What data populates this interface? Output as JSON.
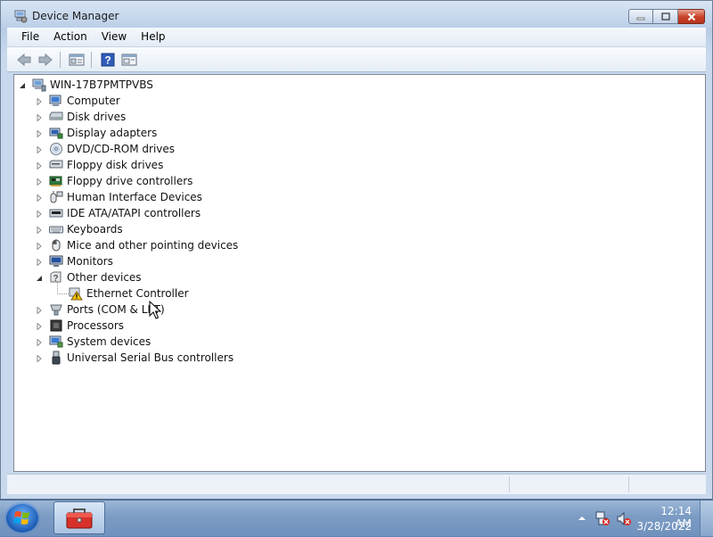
{
  "window": {
    "title": "Device Manager"
  },
  "menu": [
    "File",
    "Action",
    "View",
    "Help"
  ],
  "toolbar": {
    "buttons": [
      "back-icon",
      "forward-icon",
      "properties-icon",
      "help-icon",
      "details-icon"
    ]
  },
  "tree": {
    "root": {
      "label": "WIN-17B7PMTPVBS",
      "expanded": true,
      "icon": "computer-network-icon"
    },
    "categories": [
      {
        "label": "Computer",
        "icon": "computer-icon",
        "expanded": false
      },
      {
        "label": "Disk drives",
        "icon": "disk-drive-icon",
        "expanded": false
      },
      {
        "label": "Display adapters",
        "icon": "display-adapter-icon",
        "expanded": false
      },
      {
        "label": "DVD/CD-ROM drives",
        "icon": "dvd-drive-icon",
        "expanded": false
      },
      {
        "label": "Floppy disk drives",
        "icon": "floppy-disk-icon",
        "expanded": false
      },
      {
        "label": "Floppy drive controllers",
        "icon": "floppy-controller-icon",
        "expanded": false
      },
      {
        "label": "Human Interface Devices",
        "icon": "hid-icon",
        "expanded": false
      },
      {
        "label": "IDE ATA/ATAPI controllers",
        "icon": "ide-controller-icon",
        "expanded": false
      },
      {
        "label": "Keyboards",
        "icon": "keyboard-icon",
        "expanded": false
      },
      {
        "label": "Mice and other pointing devices",
        "icon": "mouse-icon",
        "expanded": false
      },
      {
        "label": "Monitors",
        "icon": "monitor-icon",
        "expanded": false
      },
      {
        "label": "Other devices",
        "icon": "unknown-device-icon",
        "expanded": true,
        "children": [
          {
            "label": "Ethernet Controller",
            "icon": "warning-device-icon"
          }
        ]
      },
      {
        "label": "Ports (COM & LPT)",
        "icon": "port-icon",
        "expanded": false
      },
      {
        "label": "Processors",
        "icon": "processor-icon",
        "expanded": false
      },
      {
        "label": "System devices",
        "icon": "system-device-icon",
        "expanded": false
      },
      {
        "label": "Universal Serial Bus controllers",
        "icon": "usb-icon",
        "expanded": false
      }
    ]
  },
  "taskbar": {
    "start_icon": "windows-start-icon",
    "pinned_app_icon": "toolbox-icon",
    "tray_icons": [
      "show-hidden-icons-arrow",
      "network-disconnected-icon",
      "volume-muted-icon"
    ],
    "time": "12:14 AM",
    "date": "3/28/2022"
  },
  "colors": {
    "selection_warning": "#f5c400",
    "titlebar": "#c6d7ec",
    "close_button": "#c9452d",
    "taskbar": "#7c9cc4"
  }
}
